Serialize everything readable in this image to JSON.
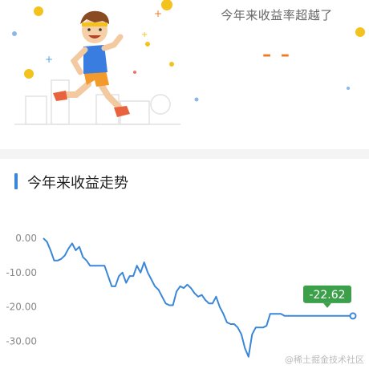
{
  "hero": {
    "beat_text": "今年来收益率超越了",
    "beat_value": "– –"
  },
  "section": {
    "title": "今年来收益走势"
  },
  "chart_data": {
    "type": "line",
    "title": "今年来收益走势",
    "xlabel": "",
    "ylabel": "",
    "ylim": [
      -35,
      2
    ],
    "yticks": [
      0,
      -10,
      -20,
      -30
    ],
    "ytick_labels": [
      "0.00",
      "-10.00",
      "-20.00",
      "-30.00"
    ],
    "grid": false,
    "line_color": "#3a87d8",
    "label_color": "#3ca04a",
    "last_label": "-22.62",
    "values": [
      0,
      -1,
      -3.5,
      -6.5,
      -6.5,
      -6,
      -5,
      -3,
      -1.5,
      -3.5,
      -2.5,
      -5.5,
      -6.5,
      -8,
      -8,
      -8,
      -8,
      -8,
      -11,
      -14,
      -14,
      -11,
      -10,
      -13,
      -11,
      -11,
      -8,
      -10,
      -7,
      -10,
      -12,
      -14,
      -15,
      -17,
      -19,
      -19.5,
      -19.5,
      -15.5,
      -14,
      -14.5,
      -13.5,
      -14.5,
      -16,
      -17,
      -16.5,
      -18,
      -19,
      -19,
      -17,
      -20,
      -22,
      -24.5,
      -25,
      -25,
      -26,
      -28,
      -32,
      -34.5,
      -28,
      -26,
      -26,
      -26,
      -25.5,
      -22,
      -22,
      -22,
      -22,
      -22.62,
      -22.62,
      -22.62,
      -22.62,
      -22.62,
      -22.62,
      -22.62,
      -22.62,
      -22.62,
      -22.62,
      -22.62,
      -22.62,
      -22.62,
      -22.62,
      -22.62,
      -22.62,
      -22.62,
      -22.62,
      -22.62,
      -22.62
    ]
  },
  "watermark": "@稀土掘金技术社区",
  "colors": {
    "accent": "#3a87d8",
    "highlight": "#f07a20",
    "badge": "#3ca04a"
  }
}
